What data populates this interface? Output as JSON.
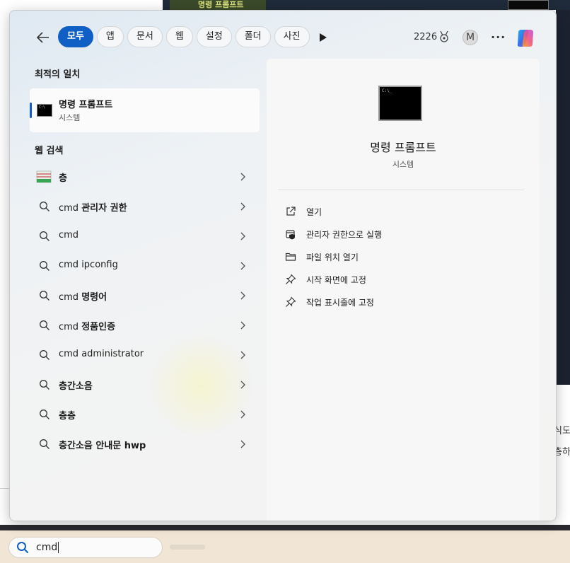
{
  "background": {
    "tile_title": "명령 프롬프트",
    "right_text_1": "식도",
    "right_text_2": "층하"
  },
  "header": {
    "tabs": [
      {
        "label": "모두",
        "active": true
      },
      {
        "label": "앱"
      },
      {
        "label": "문서"
      },
      {
        "label": "웹"
      },
      {
        "label": "설정"
      },
      {
        "label": "폴더"
      },
      {
        "label": "사진"
      }
    ],
    "points": "2226",
    "avatar_initial": "M",
    "more_label": "···"
  },
  "best_match": {
    "section_label": "최적의 일치",
    "title": "명령 프롬프트",
    "subtitle": "시스템"
  },
  "web_search": {
    "section_label": "웹 검색",
    "results": [
      {
        "prefix": "",
        "bold": "층",
        "icon": "floor-image-icon"
      },
      {
        "prefix": "cmd ",
        "bold": "관리자 권한",
        "icon": "search-icon"
      },
      {
        "prefix": "cmd",
        "bold": "",
        "icon": "search-icon"
      },
      {
        "prefix": "cmd ipconfig",
        "bold": "",
        "icon": "search-icon"
      },
      {
        "prefix": "cmd ",
        "bold": "명령어",
        "icon": "search-icon"
      },
      {
        "prefix": "cmd ",
        "bold": "정품인증",
        "icon": "search-icon"
      },
      {
        "prefix": "cmd administrator",
        "bold": "",
        "icon": "search-icon"
      },
      {
        "prefix": "",
        "bold": "층간소음",
        "icon": "search-icon"
      },
      {
        "prefix": "",
        "bold": "층층",
        "icon": "search-icon"
      },
      {
        "prefix": "",
        "bold": "층간소음 안내문 hwp",
        "icon": "search-icon"
      }
    ]
  },
  "detail": {
    "title": "명령 프롬프트",
    "subtitle": "시스템",
    "actions": [
      {
        "label": "열기",
        "icon": "open-external-icon"
      },
      {
        "label": "관리자 권한으로 실행",
        "icon": "shield-admin-icon"
      },
      {
        "label": "파일 위치 열기",
        "icon": "folder-icon"
      },
      {
        "label": "시작 화면에 고정",
        "icon": "pin-icon"
      },
      {
        "label": "작업 표시줄에 고정",
        "icon": "pin-icon"
      }
    ]
  },
  "taskbar": {
    "search_value": "cmd"
  },
  "colors": {
    "accent": "#0f5fc5",
    "taskbar": "#f1e6d6",
    "detail_bg": "#f7f7f7"
  }
}
